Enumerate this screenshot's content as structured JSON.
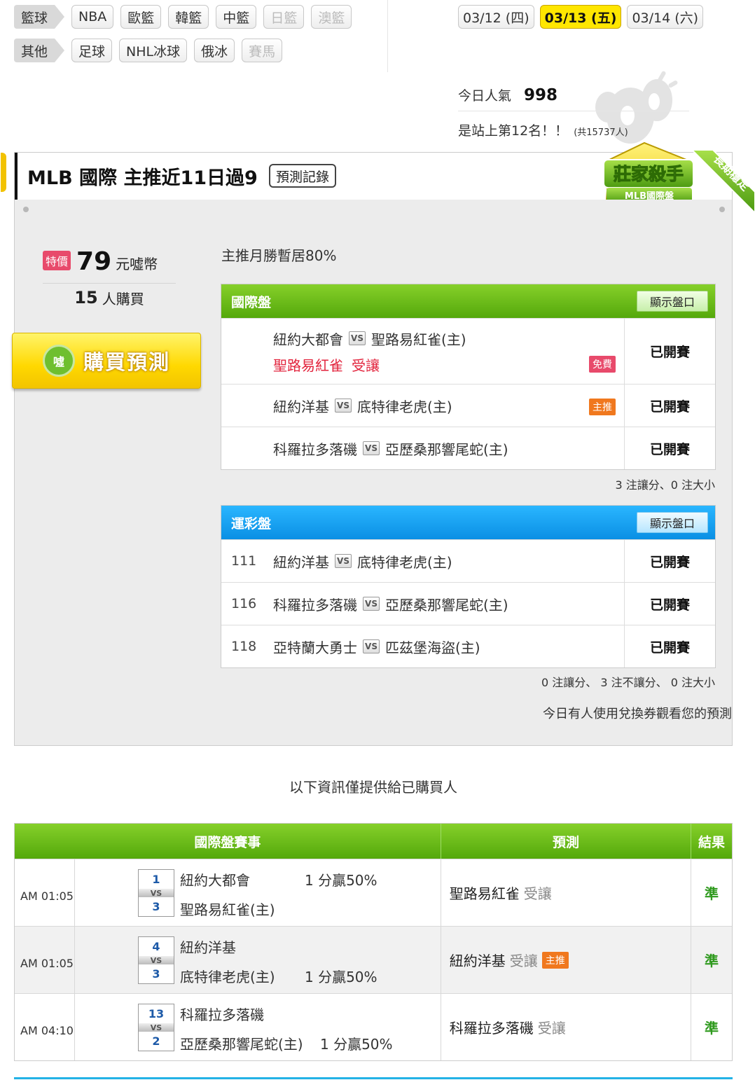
{
  "nav": {
    "row1": {
      "category": "籃球",
      "items": [
        {
          "label": "NBA",
          "disabled": false
        },
        {
          "label": "歐籃",
          "disabled": false
        },
        {
          "label": "韓籃",
          "disabled": false
        },
        {
          "label": "中籃",
          "disabled": false
        },
        {
          "label": "日籃",
          "disabled": true
        },
        {
          "label": "澳籃",
          "disabled": true
        }
      ]
    },
    "row2": {
      "category": "其他",
      "items": [
        {
          "label": "足球",
          "disabled": false
        },
        {
          "label": "NHL冰球",
          "disabled": false
        },
        {
          "label": "俄冰",
          "disabled": false
        },
        {
          "label": "賽馬",
          "disabled": true
        }
      ]
    }
  },
  "dates": [
    {
      "label": "03/12 (四)",
      "active": false
    },
    {
      "label": "03/13 (五)",
      "active": true
    },
    {
      "label": "03/14 (六)",
      "active": false
    }
  ],
  "popularity": {
    "label": "今日人氣",
    "value": "998"
  },
  "rank": {
    "text": "是站上第12名！！",
    "total": "(共15737人)"
  },
  "expert": {
    "title": "MLB 國際 主推近11日過9",
    "record_button": "預測記錄",
    "badge_title": "莊家殺手",
    "badge_sub": "MLB國際盤",
    "ribbon": "長期穩定"
  },
  "purchase": {
    "special_tag": "特價",
    "price": "79",
    "unit": "元噓幣",
    "buyers_count": "15",
    "buyers_label": "人購買",
    "buy_button": "購買預測",
    "coin_label": "噓"
  },
  "monthly_note": "主推月勝暫居80%",
  "intl_block": {
    "title": "國際盤",
    "show_button": "顯示盤口",
    "vs": "VS",
    "rows": [
      {
        "away": "紐約大都會",
        "home": "聖路易紅雀(主)",
        "pick_team": "聖路易紅雀",
        "pick_side": "受讓",
        "tag": "免費",
        "status": "已開賽"
      },
      {
        "away": "紐約洋基",
        "home": "底特律老虎(主)",
        "tag": "主推",
        "status": "已開賽"
      },
      {
        "away": "科羅拉多落磯",
        "home": "亞歷桑那響尾蛇(主)",
        "status": "已開賽"
      }
    ],
    "summary": "3 注讓分、0 注大小"
  },
  "sport_block": {
    "title": "運彩盤",
    "show_button": "顯示盤口",
    "vs": "VS",
    "rows": [
      {
        "code": "111",
        "away": "紐約洋基",
        "home": "底特律老虎(主)",
        "status": "已開賽"
      },
      {
        "code": "116",
        "away": "科羅拉多落磯",
        "home": "亞歷桑那響尾蛇(主)",
        "status": "已開賽"
      },
      {
        "code": "118",
        "away": "亞特蘭大勇士",
        "home": "匹茲堡海盜(主)",
        "status": "已開賽"
      }
    ],
    "summary": "0 注讓分、 3 注不讓分、 0 注大小"
  },
  "voucher_note": "今日有人使用兌換券觀看您的預測",
  "notice": "以下資訊僅提供給已購買人",
  "results": {
    "headers": [
      "國際盤賽事",
      "預測",
      "結果"
    ],
    "rows": [
      {
        "time": "AM 01:05",
        "score_away": "1",
        "score_home": "3",
        "vs": "VS",
        "away": "紐約大都會",
        "home": "聖路易紅雀(主)",
        "handicap": "1 分贏50%",
        "handicap_row": "away",
        "pred_team": "聖路易紅雀",
        "pred_side": "受讓",
        "pred_tag": "",
        "result": "準"
      },
      {
        "time": "AM 01:05",
        "score_away": "4",
        "score_home": "3",
        "vs": "VS",
        "away": "紐約洋基",
        "home": "底特律老虎(主)",
        "handicap": "1 分贏50%",
        "handicap_row": "home",
        "pred_team": "紐約洋基",
        "pred_side": "受讓",
        "pred_tag": "主推",
        "result": "準"
      },
      {
        "time": "AM 04:10",
        "score_away": "13",
        "score_home": "2",
        "vs": "VS",
        "away": "科羅拉多落磯",
        "home": "亞歷桑那響尾蛇(主)",
        "handicap": "1 分贏50%",
        "handicap_row": "home",
        "pred_team": "科羅拉多落磯",
        "pred_side": "受讓",
        "pred_tag": "",
        "result": "準"
      }
    ]
  }
}
